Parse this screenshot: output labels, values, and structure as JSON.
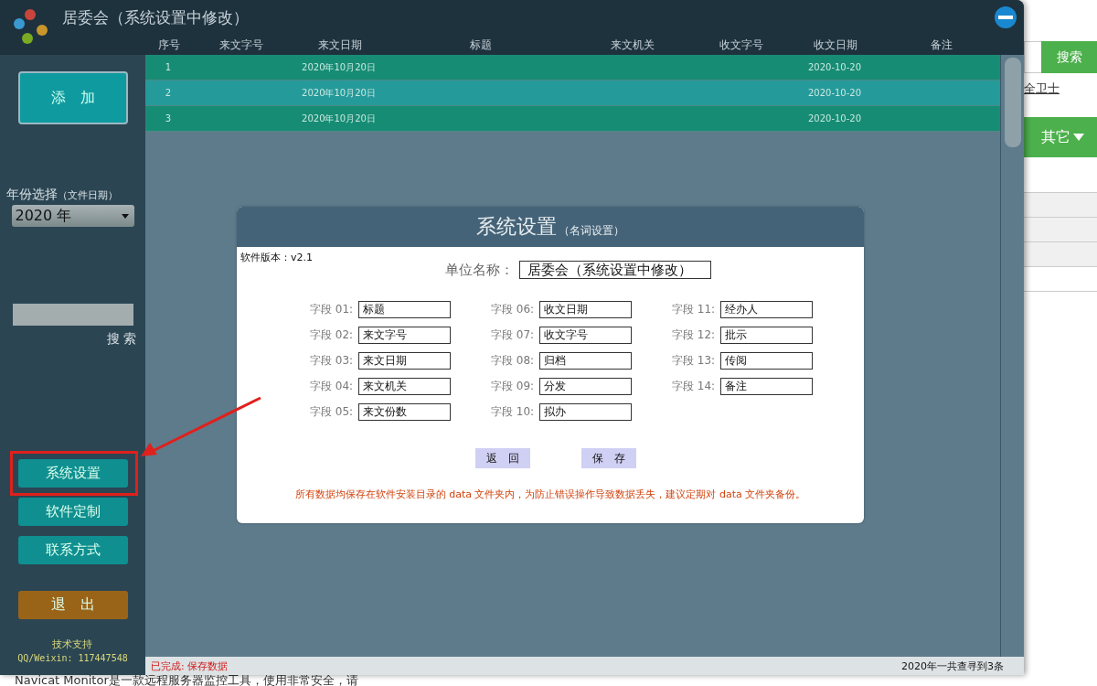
{
  "window": {
    "title": "居委会（系统设置中修改）"
  },
  "table": {
    "columns": [
      "序号",
      "来文字号",
      "来文日期",
      "标题",
      "来文机关",
      "收文字号",
      "收文日期",
      "备注"
    ],
    "rows": [
      {
        "number": "1",
        "incoming_date": "2020年10月20日",
        "received_date": "2020-10-20",
        "selected": false
      },
      {
        "number": "2",
        "incoming_date": "2020年10月20日",
        "received_date": "2020-10-20",
        "selected": true
      },
      {
        "number": "3",
        "incoming_date": "2020年10月20日",
        "received_date": "2020-10-20",
        "selected": false
      }
    ]
  },
  "sidebar": {
    "add_button": "添　加",
    "year_select": {
      "label": "年份选择",
      "hint": "（文件日期）",
      "value": "2020 年"
    },
    "search_button": "搜 索",
    "buttons": [
      {
        "label": "系统设置",
        "kind": "menu",
        "annotated": true
      },
      {
        "label": "软件定制",
        "kind": "menu",
        "annotated": false
      },
      {
        "label": "联系方式",
        "kind": "menu",
        "annotated": false
      },
      {
        "label": "退　出",
        "kind": "exit",
        "annotated": false
      }
    ],
    "support": {
      "title": "技术支持",
      "contact": "QQ/Weixin: 117447548"
    }
  },
  "dialog": {
    "title": "系统设置",
    "subtitle": "（名词设置）",
    "version": "软件版本：v2.1",
    "unit_label": "单位名称：",
    "unit_value": "居委会（系统设置中修改）",
    "fields": [
      {
        "label": "字段 01:",
        "value": "标题"
      },
      {
        "label": "字段 02:",
        "value": "来文字号"
      },
      {
        "label": "字段 03:",
        "value": "来文日期"
      },
      {
        "label": "字段 04:",
        "value": "来文机关"
      },
      {
        "label": "字段 05:",
        "value": "来文份数"
      },
      {
        "label": "字段 06:",
        "value": "收文日期"
      },
      {
        "label": "字段 07:",
        "value": "收文字号"
      },
      {
        "label": "字段 08:",
        "value": "归档"
      },
      {
        "label": "字段 09:",
        "value": "分发"
      },
      {
        "label": "字段 10:",
        "value": "拟办"
      },
      {
        "label": "字段 11:",
        "value": "经办人"
      },
      {
        "label": "字段 12:",
        "value": "批示"
      },
      {
        "label": "字段 13:",
        "value": "传阅"
      },
      {
        "label": "字段 14:",
        "value": "备注"
      }
    ],
    "buttons": [
      "返　回",
      "保　存"
    ],
    "notice": "所有数据均保存在软件安装目录的 data 文件夹内，为防止错误操作导致数据丢失，建议定期对 data 文件夹备份。"
  },
  "status_bar": {
    "left": "已完成: 保存数据",
    "right": "2020年一共查寻到3条"
  },
  "background_page": {
    "search_button": "搜索",
    "link": "全卫士",
    "menu": "其它",
    "bottom_text": "Navicat Monitor是一款远程服务器监控工具，使用非常安全，请"
  }
}
